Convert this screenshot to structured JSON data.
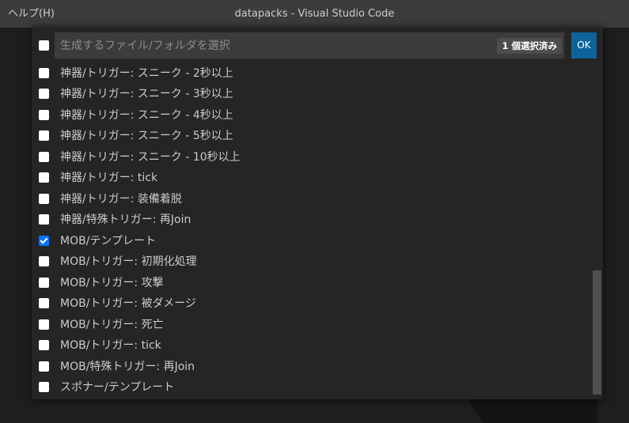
{
  "titlebar": {
    "menu_help": "ヘルプ(H)",
    "window_title": "datapacks - Visual Studio Code"
  },
  "quickpick": {
    "placeholder": "生成するファイル/フォルダを選択",
    "selected_count": "1 個選択済み",
    "ok_label": "OK",
    "items": [
      {
        "label": "神器/トリガー: スニーク - 2秒以上",
        "checked": false
      },
      {
        "label": "神器/トリガー: スニーク - 3秒以上",
        "checked": false
      },
      {
        "label": "神器/トリガー: スニーク - 4秒以上",
        "checked": false
      },
      {
        "label": "神器/トリガー: スニーク - 5秒以上",
        "checked": false
      },
      {
        "label": "神器/トリガー: スニーク - 10秒以上",
        "checked": false
      },
      {
        "label": "神器/トリガー: tick",
        "checked": false
      },
      {
        "label": "神器/トリガー: 装備着脱",
        "checked": false
      },
      {
        "label": "神器/特殊トリガー: 再Join",
        "checked": false
      },
      {
        "label": "MOB/テンプレート",
        "checked": true
      },
      {
        "label": "MOB/トリガー: 初期化処理",
        "checked": false
      },
      {
        "label": "MOB/トリガー: 攻撃",
        "checked": false
      },
      {
        "label": "MOB/トリガー: 被ダメージ",
        "checked": false
      },
      {
        "label": "MOB/トリガー: 死亡",
        "checked": false
      },
      {
        "label": "MOB/トリガー: tick",
        "checked": false
      },
      {
        "label": "MOB/特殊トリガー: 再Join",
        "checked": false
      },
      {
        "label": "スポナー/テンプレート",
        "checked": false
      }
    ]
  }
}
